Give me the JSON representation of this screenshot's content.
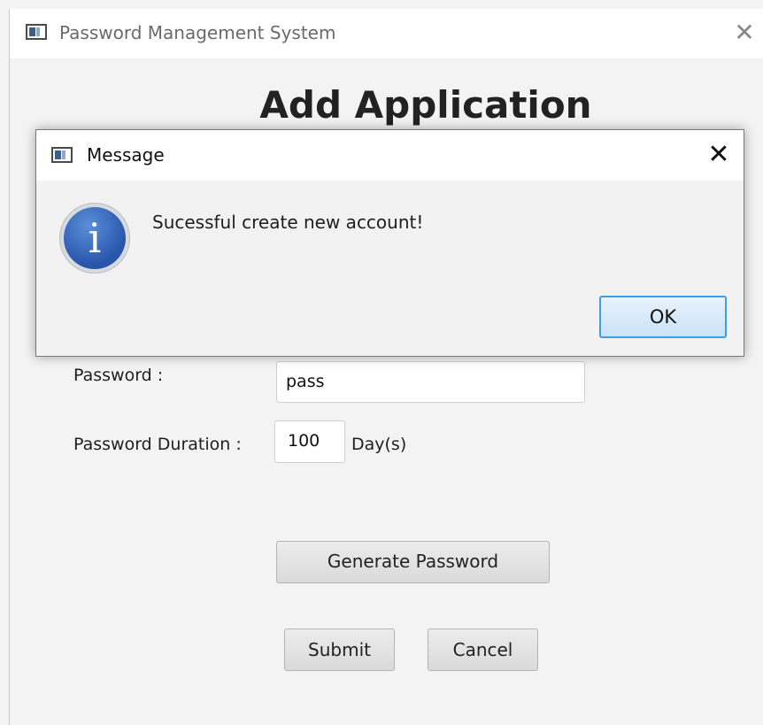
{
  "main_window": {
    "title": "Password Management System",
    "close_glyph": "✕",
    "heading": "Add Application"
  },
  "form": {
    "password_label": "Password :",
    "password_value": "pass",
    "duration_label": "Password Duration :",
    "duration_value": "100",
    "duration_unit": "Day(s)",
    "generate_label": "Generate Password",
    "submit_label": "Submit",
    "cancel_label": "Cancel"
  },
  "dialog": {
    "title": "Message",
    "close_glyph": "✕",
    "icon_glyph": "i",
    "message": "Sucessful create new account!",
    "ok_label": "OK"
  },
  "icons": {
    "app": "app-window-icon",
    "info": "info-icon",
    "close": "close-icon"
  },
  "colors": {
    "accent_focus": "#3c9fe3",
    "info_blue": "#2854ac",
    "window_bg": "#f3f3f3"
  }
}
